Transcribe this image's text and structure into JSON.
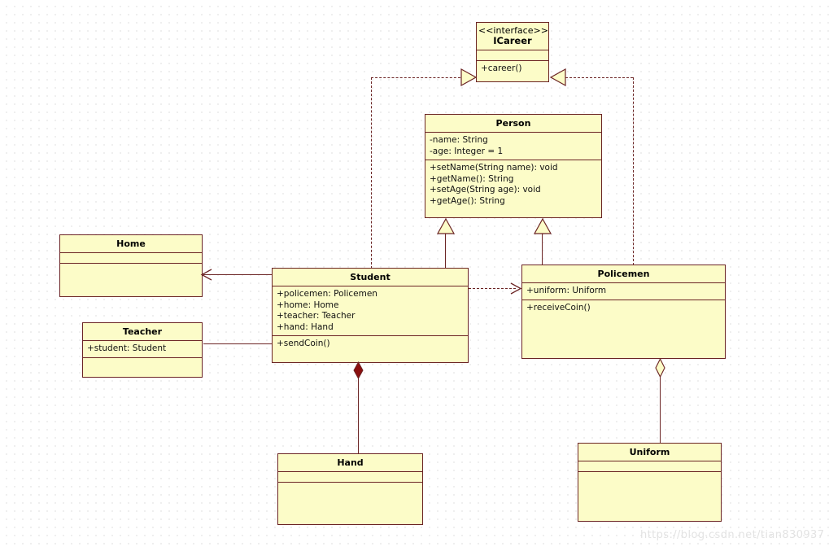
{
  "diagram": {
    "kind": "uml-class-diagram",
    "background": "#ffffff",
    "grid_dot_color": "#c9c9c9",
    "class_fill": "#fcfcc8",
    "class_border": "#6b2424",
    "connector_color": "#6b2424",
    "watermark": "https://blog.csdn.net/tian830937"
  },
  "classes": {
    "icareer": {
      "stereotype": "<<interface>>",
      "name": "ICareer",
      "attributes": "",
      "operations": "+career()"
    },
    "person": {
      "name": "Person",
      "attributes": "-name: String\n-age: Integer = 1",
      "operations": "+setName(String name): void\n+getName(): String\n+setAge(String age): void\n+getAge(): String"
    },
    "student": {
      "name": "Student",
      "attributes": "+policemen: Policemen\n+home: Home\n+teacher: Teacher\n+hand: Hand",
      "operations": "+sendCoin()"
    },
    "policemen": {
      "name": "Policemen",
      "attributes": "+uniform: Uniform",
      "operations": "+receiveCoin()"
    },
    "home": {
      "name": "Home",
      "attributes": "",
      "operations": ""
    },
    "teacher": {
      "name": "Teacher",
      "attributes": "+student: Student",
      "operations": ""
    },
    "hand": {
      "name": "Hand",
      "attributes": "",
      "operations": ""
    },
    "uniform": {
      "name": "Uniform",
      "attributes": "",
      "operations": ""
    }
  },
  "relationships": [
    {
      "id": "student-realizes-icareer",
      "type": "realization",
      "from": "Student",
      "to": "ICareer",
      "style": "dashed",
      "arrow": "hollow-triangle"
    },
    {
      "id": "policemen-realizes-icareer",
      "type": "realization",
      "from": "Policemen",
      "to": "ICareer",
      "style": "dashed",
      "arrow": "hollow-triangle"
    },
    {
      "id": "student-extends-person",
      "type": "generalization",
      "from": "Student",
      "to": "Person",
      "style": "solid",
      "arrow": "hollow-triangle"
    },
    {
      "id": "policemen-extends-person",
      "type": "generalization",
      "from": "Policemen",
      "to": "Person",
      "style": "solid",
      "arrow": "hollow-triangle"
    },
    {
      "id": "student-depends-policemen",
      "type": "dependency",
      "from": "Student",
      "to": "Policemen",
      "style": "dashed",
      "arrow": "open"
    },
    {
      "id": "student-assoc-home",
      "type": "association",
      "from": "Student",
      "to": "Home",
      "style": "solid",
      "arrow": "open"
    },
    {
      "id": "teacher-assoc-student",
      "type": "association",
      "from": "Teacher",
      "to": "Student",
      "style": "solid",
      "arrow": "none"
    },
    {
      "id": "student-composes-hand",
      "type": "composition",
      "from": "Student",
      "to": "Hand",
      "style": "solid",
      "arrow": "filled-diamond"
    },
    {
      "id": "policemen-aggregates-uniform",
      "type": "aggregation",
      "from": "Policemen",
      "to": "Uniform",
      "style": "solid",
      "arrow": "hollow-diamond"
    }
  ]
}
